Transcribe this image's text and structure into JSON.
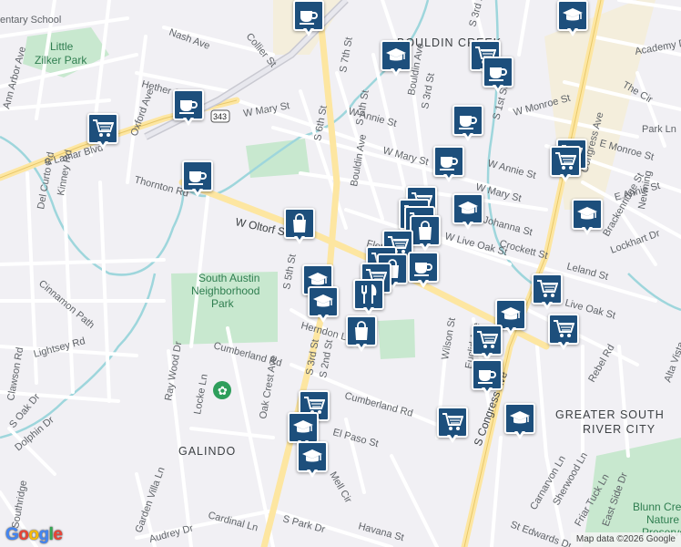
{
  "map": {
    "attribution": "Map data ©2026 Google",
    "logo_text": "Google"
  },
  "area_labels": [
    "BOULDIN CREEK",
    "GREATER SOUTH",
    "RIVER CITY",
    "GALINDO"
  ],
  "park_labels": [
    "Little",
    "Zilker Park",
    "South Austin",
    "Neighborhood",
    "Park",
    "Blunn Creek",
    "Nature",
    "Preserve"
  ],
  "street_labels": [
    "entary School",
    "Nash Ave",
    "Collier St",
    "Hether St",
    "Oxford Ave",
    "Kinney Ave",
    "W Mary St",
    "S Lamar Blvd",
    "343",
    "Kinney Rd",
    "Del Curto Rd",
    "Thornton Rd",
    "W Oltorf St",
    "S 5th St",
    "Cinnamon Path",
    "Lightsey Rd",
    "Clawson Rd",
    "S Oak Dr",
    "Dolphin Dr",
    "Southridge",
    "Ray Wood Dr",
    "Locke Ln",
    "Oak Crest Ave",
    "S 3rd St",
    "S 2nd St",
    "Herndon Ln",
    "Cumberland Rd",
    "Cumberland Rd",
    "El Paso St",
    "Mell Cir",
    "Garden Villa Ln",
    "Audrey Dr",
    "Cardinal Ln",
    "S Park Dr",
    "Havana St",
    "St Edwards Dr",
    "S 7th St",
    "S 6th St",
    "S 5th St",
    "Bouldin Ave",
    "S 3rd St",
    "W Annie St",
    "W Mary St",
    "W Monroe St",
    "S 1st St",
    "W Annie St",
    "W Mary St",
    "Johanna St",
    "W Live Oak St",
    "Crockett St",
    "Leland St",
    "Live Oak St",
    "Wilson St",
    "Euclid Ave",
    "S Congress Ave",
    "Rebel Rd",
    "E Monroe St",
    "E Annie St",
    "Lockhart Dr",
    "Brackenridge St",
    "Newning",
    "Park Ln",
    "The Cir",
    "Academy Dr",
    "Carnarvon Ln",
    "Sherwood Ln",
    "Friar Tuck Ln",
    "East Side Dr",
    "Alta Vista",
    "Ann Arbor Ave",
    "Fletcher St",
    "S 3rd St",
    "Congress Ave"
  ],
  "poi_icons": [
    {
      "type": "cafe",
      "icon": "coffee-cup-icon"
    },
    {
      "type": "school",
      "icon": "graduation-cap-icon"
    },
    {
      "type": "grocery",
      "icon": "shopping-cart-icon"
    },
    {
      "type": "shopping",
      "icon": "shopping-bag-icon"
    },
    {
      "type": "restaurant",
      "icon": "fork-knife-icon"
    }
  ]
}
